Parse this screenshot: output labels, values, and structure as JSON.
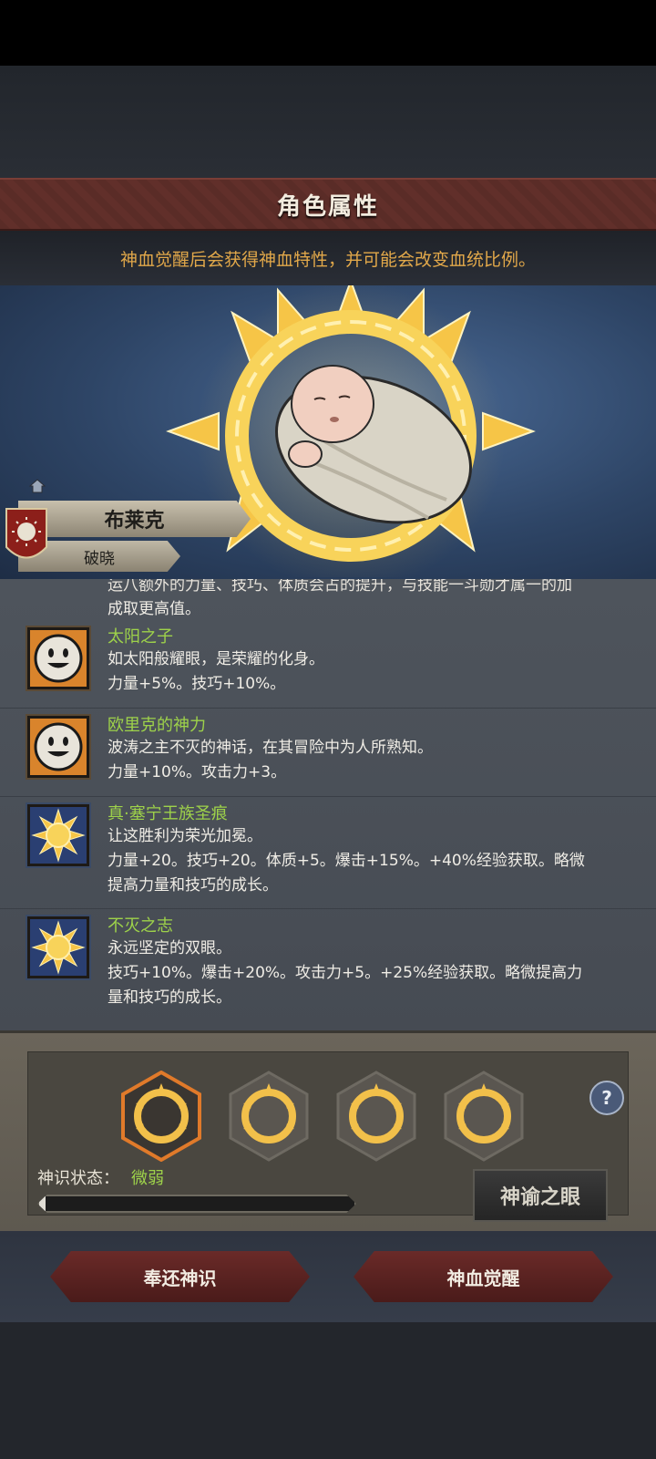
{
  "header": {
    "title": "角色属性"
  },
  "notice": {
    "text": "神血觉醒后会获得神血特性，并可能会改变血统比例。"
  },
  "character": {
    "name": "布莱克",
    "title": "破晓"
  },
  "traits_partial": {
    "cut_line": "运八额外的力量、技巧、体质会占的提升，与技能一斗勋才属一的加",
    "last_line": "成取更高值。"
  },
  "traits": [
    {
      "name": "太阳之子",
      "icon": "smiley-face-icon",
      "lines": [
        "如太阳般耀眼，是荣耀的化身。",
        "力量+5%。技巧+10%。"
      ]
    },
    {
      "name": "欧里克的神力",
      "icon": "smiley-face-icon",
      "lines": [
        "波涛之主不灭的神话，在其冒险中为人所熟知。",
        "力量+10%。攻击力+3。"
      ]
    },
    {
      "name": "真·塞宁王族圣痕",
      "icon": "sun-icon",
      "lines": [
        "让这胜利为荣光加冕。",
        "力量+20。技巧+20。体质+5。爆击+15%。+40%经验获取。略微",
        "提高力量和技巧的成长。"
      ]
    },
    {
      "name": "不灭之志",
      "icon": "sun-icon",
      "lines": [
        "永远坚定的双眼。",
        "技巧+10%。爆击+20%。攻击力+5。+25%经验获取。略微提高力",
        "量和技巧的成长。"
      ]
    }
  ],
  "divine": {
    "status_label": "神识状态：",
    "status_value": "微弱",
    "progress": 0.02,
    "oracle_button": "神谕之眼"
  },
  "actions": {
    "return_label": "奉还神识",
    "awaken_label": "神血觉醒"
  },
  "colors": {
    "accent_green": "#9ed24a",
    "notice_gold": "#e2a84a",
    "banner_red": "#5a2c27"
  }
}
